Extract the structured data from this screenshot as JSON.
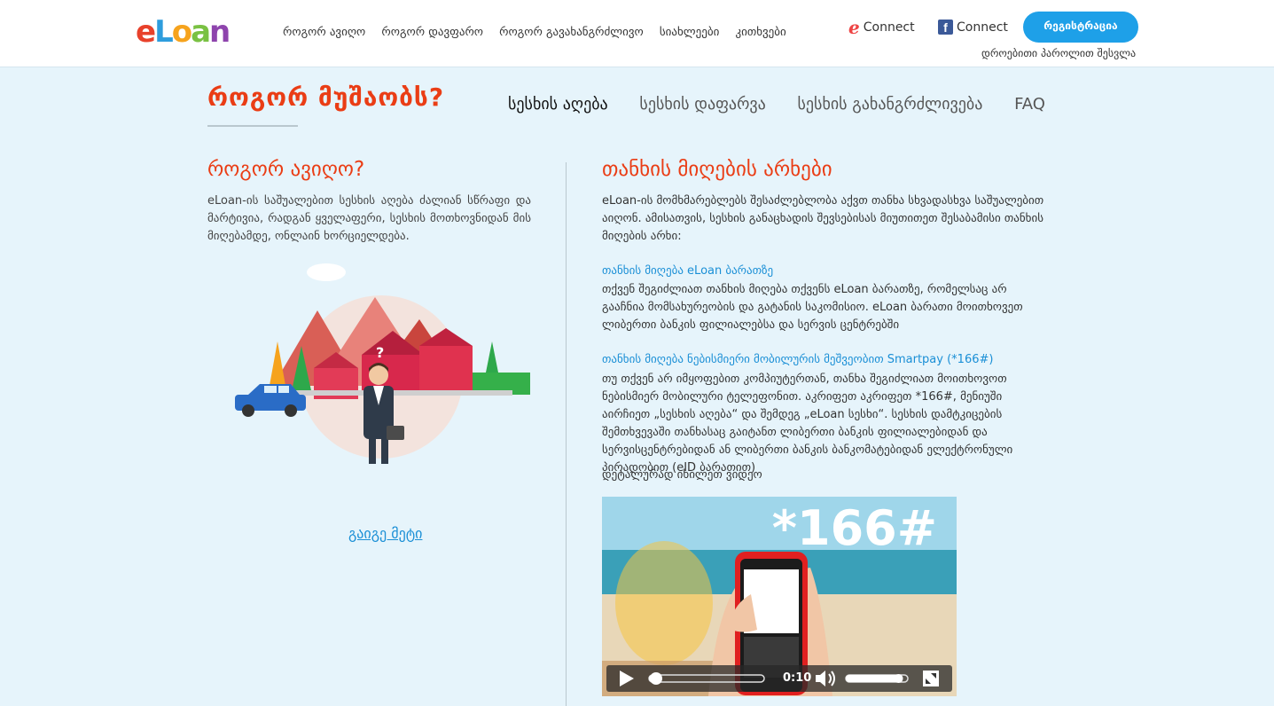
{
  "header": {
    "logo_text": "eLoan",
    "nav": [
      "როგორ ავიღო",
      "როგორ დავფარო",
      "როგორ გავახანგრძლივო",
      "სიახლეები",
      "კითხვები"
    ],
    "connect_e_label": "Connect",
    "connect_fb_label": "Connect",
    "register_label": "რეგისტრაცია",
    "temp_login_label": "დროებითი პაროლით შესვლა"
  },
  "page": {
    "title": "როგორ მუშაობს?",
    "tabs": [
      "სესხის აღება",
      "სესხის დაფარვა",
      "სესხის გახანგრძლივება",
      "FAQ"
    ],
    "active_tab": "სესხის აღება"
  },
  "left": {
    "heading": "როგორ ავიღო?",
    "paragraph": "eLoan-ის საშუალებით სესხის აღება ძალიან სწრაფი და მარტივია, რადგან ყველაფერი, სესხის მოთხოვნიდან მის მიღებამდე, ონლაინ ხორციელდება.",
    "more_link": "გაიგე მეტი"
  },
  "right": {
    "heading": "თანხის მიღების არხები",
    "paragraph": "eLoan-ის მომხმარებლებს შესაძლებლობა აქვთ თანხა სხვადასხვა საშუალებით აიღონ. ამისათვის, სესხის განაცხადის შევსებისას მიუთითეთ შესაბამისი თანხის მიღების არხი:",
    "sub1_title": "თანხის მიღება eLoan ბარათზე",
    "sub1_text": "თქვენ შეგიძლიათ თანხის მიღება თქვენს eLoan ბარათზე, რომელსაც არ გააჩნია მომსახურეობის და გატანის საკომისიო. eLoan ბარათი მოითხოვეთ ლიბერთი ბანკის ფილიალებსა და სერვის ცენტრებში",
    "sub2_title": "თანხის მიღება ნებისმიერი მობილურის მეშვეობით Smartpay (*166#)",
    "sub2_text": "თუ თქვენ არ იმყოფებით კომპიუტერთან, თანხა შეგიძლიათ მოითხოვოთ ნებისმიერ მობილური ტელეფონით. აკრიფეთ აკრიფეთ *166#, მენიუში აირჩიეთ „სესხის აღება“ და შემდეგ „eLoan სესხი“. სესხის დამტკიცების შემთხვევაში თანხასაც გაიტანთ ლიბერთი ბანკის ფილიალებიდან და სერვისცენტრებიდან ან ლიბერთი ბანკის ბანკომატებიდან ელექტრონული პირადობით (eID ბარათით)",
    "see_video": "დეტალურად იხილეთ ვიდეო"
  },
  "video": {
    "overlay_text": "*166#",
    "time": "0:10",
    "progress": 0.05,
    "volume": 0.85
  },
  "colors": {
    "accent_red": "#ea3d15",
    "link_blue": "#1a8fd6",
    "button_blue": "#1ea0e8",
    "background": "#e6f4fb"
  }
}
